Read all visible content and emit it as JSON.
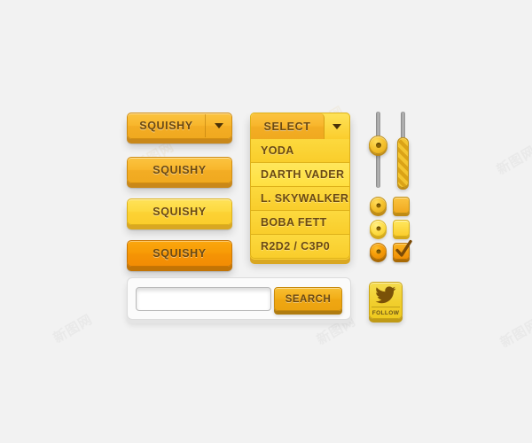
{
  "theme": {
    "background": "#f2f2f2",
    "amber": "#f8b62c",
    "yellow": "#fcd234",
    "orange": "#f79a06",
    "text_dark": "#6b4a14",
    "track_grey": "#a0a0a0",
    "panel_white": "#fbfbfb"
  },
  "watermarks": [
    {
      "text": "新图网"
    },
    {
      "text": "新图网"
    },
    {
      "text": "新图网"
    },
    {
      "text": "新图网"
    },
    {
      "text": "新图网"
    },
    {
      "text": "新图网"
    },
    {
      "text": "新图网"
    },
    {
      "text": "新图网"
    }
  ],
  "buttons": {
    "dropdown": {
      "label": "SQUISHY",
      "caret_icon": "chevron-down-icon"
    },
    "squishy_2": {
      "label": "SQUISHY"
    },
    "squishy_3": {
      "label": "SQUISHY"
    },
    "squishy_4": {
      "label": "SQUISHY"
    }
  },
  "select": {
    "header_label": "SELECT",
    "caret_icon": "chevron-down-icon",
    "items": [
      {
        "label": "YODA",
        "highlighted": false
      },
      {
        "label": "DARTH VADER",
        "highlighted": true
      },
      {
        "label": "L. SKYWALKER",
        "highlighted": false
      },
      {
        "label": "BOBA FETT",
        "highlighted": false
      },
      {
        "label": "R2D2 / C3P0",
        "highlighted": false
      }
    ]
  },
  "sliders": [
    {
      "name": "slider-knob",
      "orientation": "vertical",
      "style": "knob",
      "value": 65
    },
    {
      "name": "slider-fill",
      "orientation": "vertical",
      "style": "striped",
      "value": 35
    }
  ],
  "radios": [
    {
      "state": "selected",
      "variant": "amber"
    },
    {
      "state": "selected",
      "variant": "light"
    },
    {
      "state": "selected",
      "variant": "deep"
    }
  ],
  "checkboxes": [
    {
      "state": "unchecked",
      "variant": "amber"
    },
    {
      "state": "unchecked",
      "variant": "light"
    },
    {
      "state": "checked",
      "variant": "deep"
    }
  ],
  "search": {
    "input_value": "",
    "placeholder": "",
    "button_label": "SEARCH"
  },
  "follow": {
    "icon": "twitter-bird-icon",
    "label": "FOLLOW"
  }
}
